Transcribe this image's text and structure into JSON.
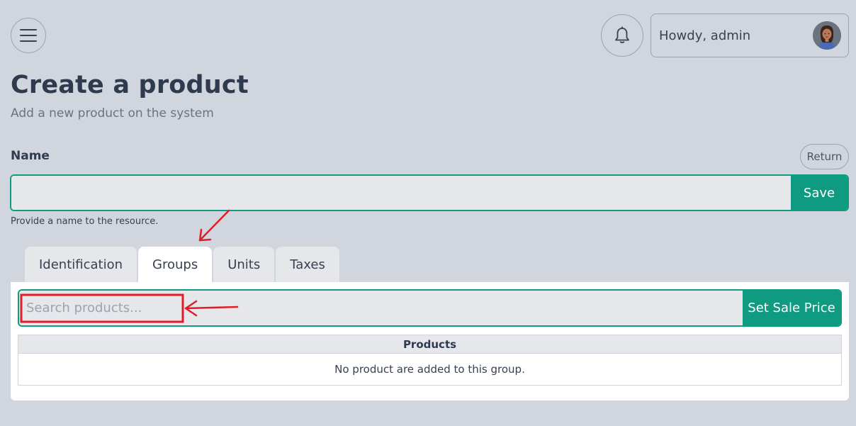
{
  "header": {
    "user_greeting": "Howdy, admin",
    "icons": {
      "menu": "hamburger-icon",
      "notifications": "bell-icon",
      "avatar": "user-avatar"
    }
  },
  "page": {
    "title": "Create a product",
    "subtitle": "Add a new product on the system"
  },
  "form": {
    "name_label": "Name",
    "return_label": "Return",
    "name_value": "",
    "save_label": "Save",
    "name_help": "Provide a name to the resource."
  },
  "tabs": [
    {
      "label": "Identification",
      "active": false
    },
    {
      "label": "Groups",
      "active": true
    },
    {
      "label": "Units",
      "active": false
    },
    {
      "label": "Taxes",
      "active": false
    }
  ],
  "groups_panel": {
    "search_placeholder": "Search products...",
    "set_sale_price_label": "Set Sale Price",
    "table_header": "Products",
    "empty_message": "No product are added to this group."
  },
  "colors": {
    "background": "#d1d5de",
    "accent": "#0f9b82",
    "annotation": "#e11d2a"
  }
}
